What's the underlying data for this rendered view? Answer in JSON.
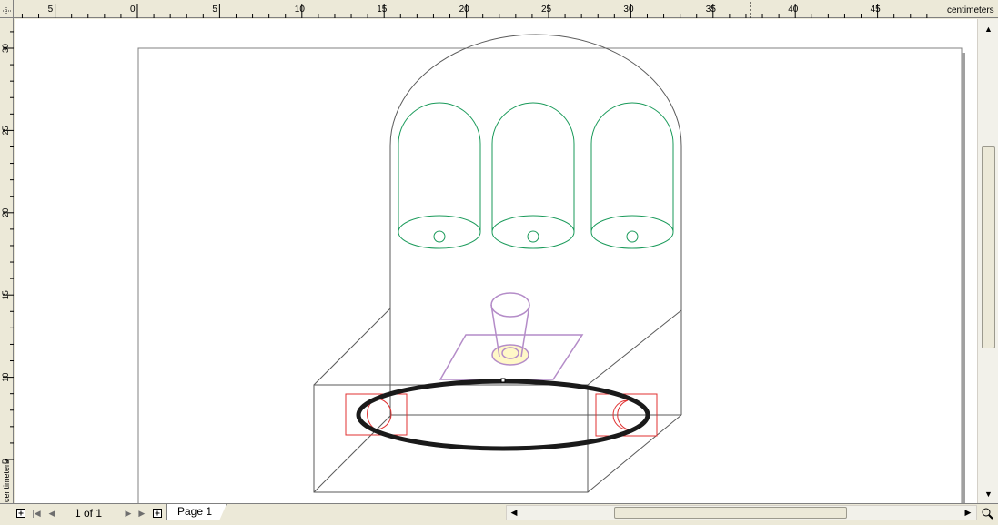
{
  "ruler": {
    "unit_label": "centimeters",
    "top_ticks": [
      "5",
      "0",
      "5",
      "10",
      "15",
      "20",
      "25",
      "30",
      "35",
      "40",
      "45"
    ],
    "left_ticks": [
      "30",
      "25",
      "20",
      "15",
      "10",
      "5"
    ],
    "left_unit_label": "centimeters"
  },
  "document": {
    "page_count_label": "1 of 1",
    "page_tab_label": "Page 1"
  },
  "colors": {
    "outline": "#5a5a5a",
    "cylinders": "#1a9a5a",
    "cup": "#b48cc8",
    "cup_fill": "#fff8c8",
    "brackets": "#e03030",
    "selected_ellipse": "#1a1a1a"
  }
}
